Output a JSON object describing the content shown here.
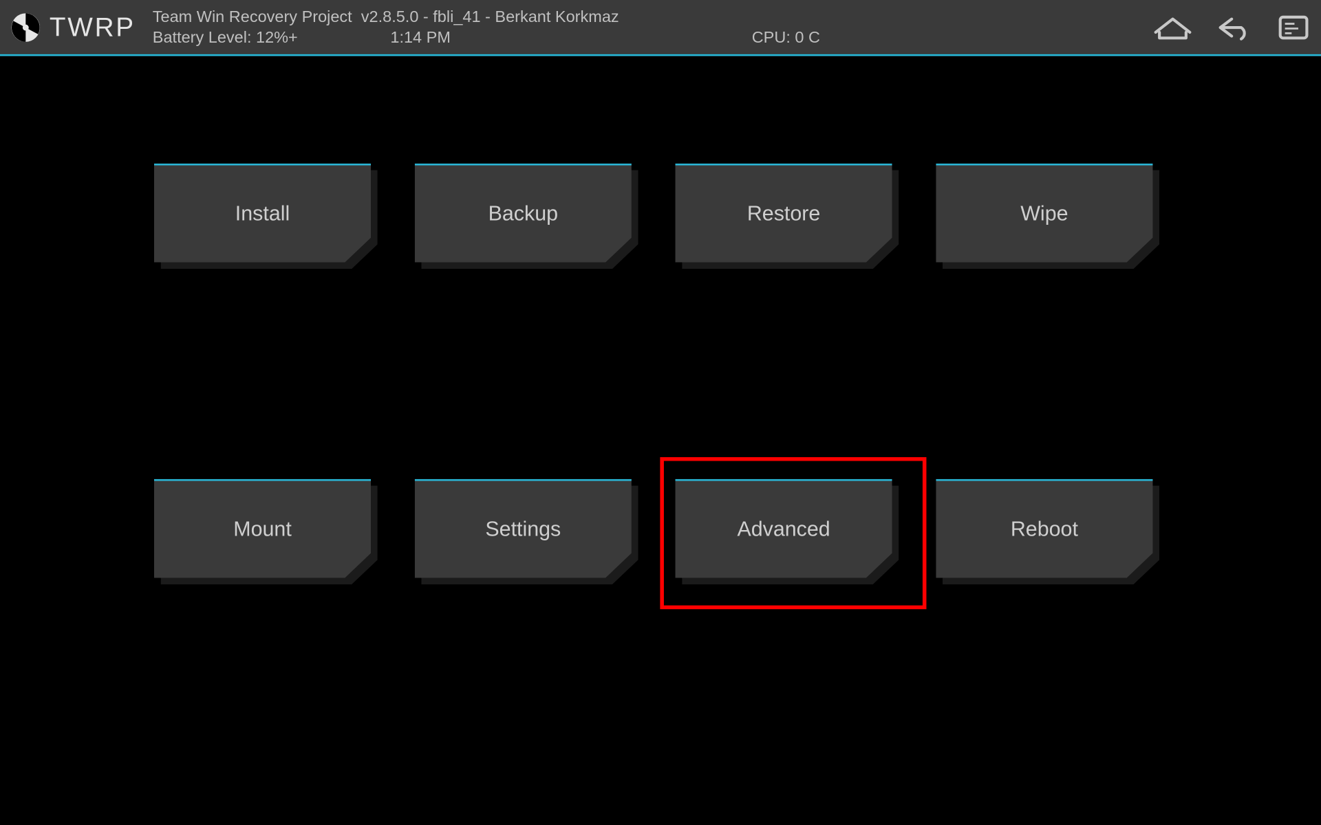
{
  "header": {
    "logo_text": "TWRP",
    "title_line": "Team Win Recovery Project  v2.8.5.0 - fbli_41 - Berkant Korkmaz",
    "battery_label": "Battery Level: 12%+",
    "time": "1:14 PM",
    "cpu": "CPU: 0 C"
  },
  "buttons": {
    "install": "Install",
    "backup": "Backup",
    "restore": "Restore",
    "wipe": "Wipe",
    "mount": "Mount",
    "settings": "Settings",
    "advanced": "Advanced",
    "reboot": "Reboot"
  },
  "highlighted": "advanced",
  "colors": {
    "accent": "#29b6d6",
    "button_bg": "#3a3a3a",
    "text": "#cfcfcf",
    "highlight": "#ff0000"
  }
}
